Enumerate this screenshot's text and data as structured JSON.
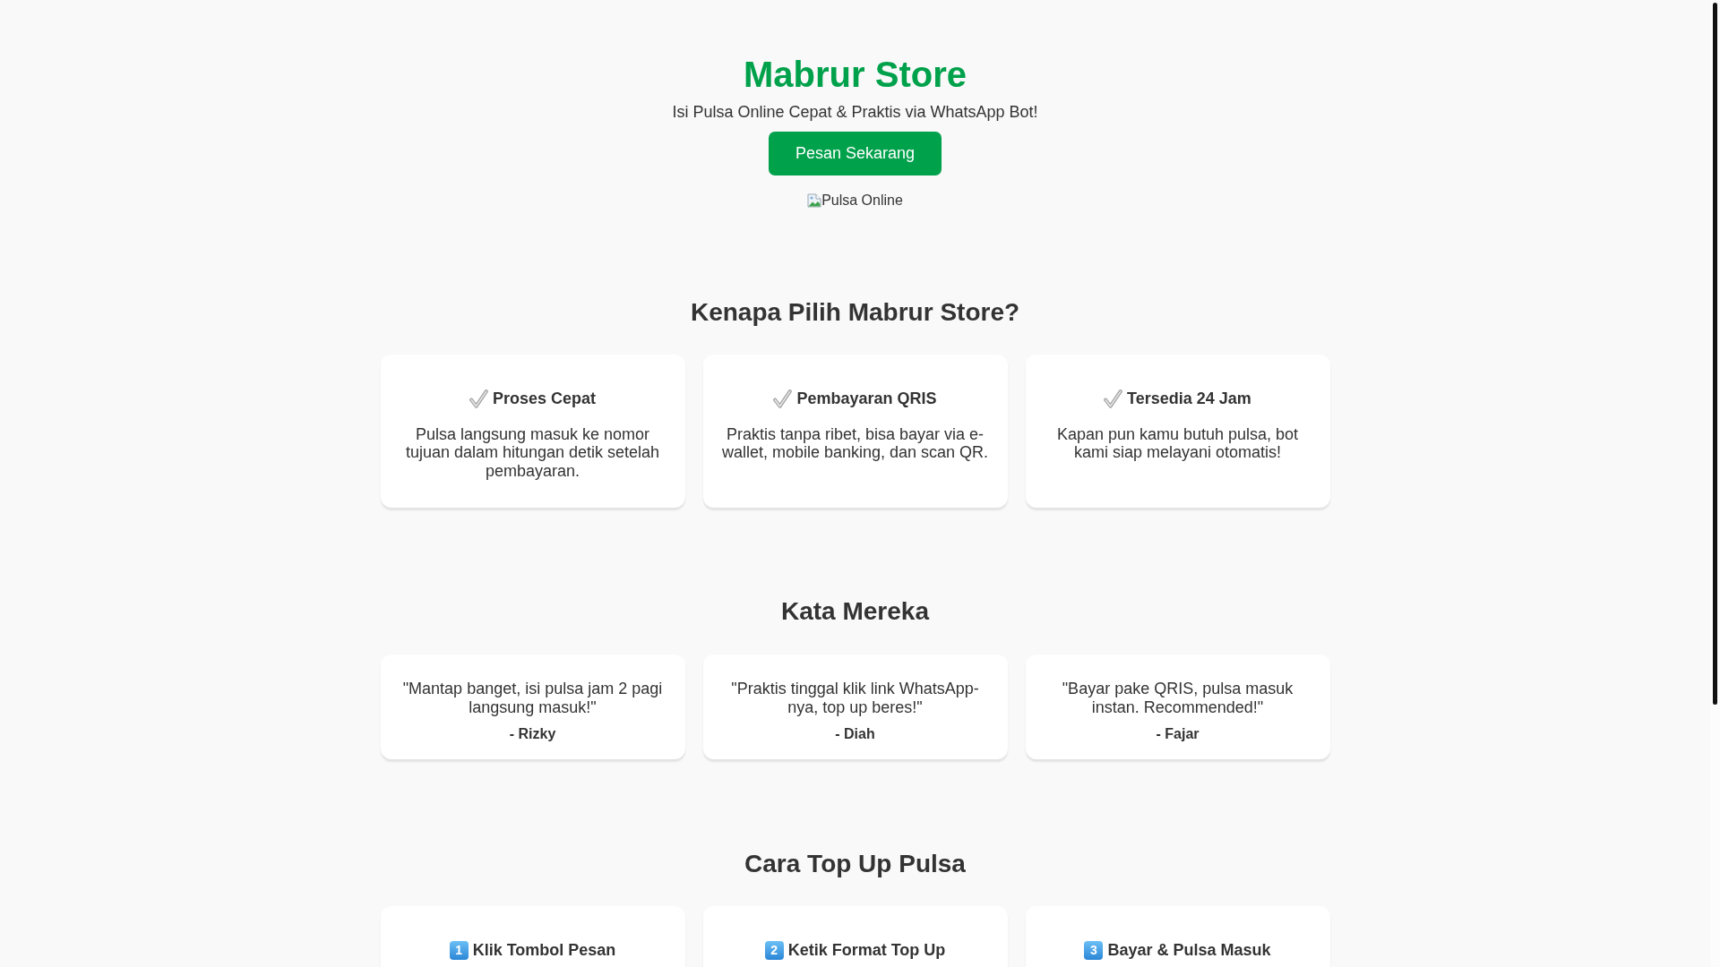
{
  "hero": {
    "title": "Mabrur Store",
    "subtitle": "Isi Pulsa Online Cepat & Praktis via WhatsApp Bot!",
    "button": "Pesan Sekarang",
    "image_alt": "Pulsa Online"
  },
  "features": {
    "heading": "Kenapa Pilih Mabrur Store?",
    "items": [
      {
        "title": "Proses Cepat",
        "text": "Pulsa langsung masuk ke nomor tujuan dalam hitungan detik setelah pembayaran."
      },
      {
        "title": "Pembayaran QRIS",
        "text": "Praktis tanpa ribet, bisa bayar via e-wallet, mobile banking, dan scan QR."
      },
      {
        "title": "Tersedia 24 Jam",
        "text": "Kapan pun kamu butuh pulsa, bot kami siap melayani otomatis!"
      }
    ]
  },
  "testimonials": {
    "heading": "Kata Mereka",
    "items": [
      {
        "quote": "\"Mantap banget, isi pulsa jam 2 pagi langsung masuk!\"",
        "author": "- Rizky"
      },
      {
        "quote": "\"Praktis tinggal klik link WhatsApp-nya, top up beres!\"",
        "author": "- Diah"
      },
      {
        "quote": "\"Bayar pake QRIS, pulsa masuk instan. Recommended!\"",
        "author": "- Fajar"
      }
    ]
  },
  "steps": {
    "heading": "Cara Top Up Pulsa",
    "items": [
      {
        "number": "1",
        "title": "Klik Tombol Pesan"
      },
      {
        "number": "2",
        "title": "Ketik Format Top Up"
      },
      {
        "number": "3",
        "title": "Bayar & Pulsa Masuk"
      }
    ]
  }
}
